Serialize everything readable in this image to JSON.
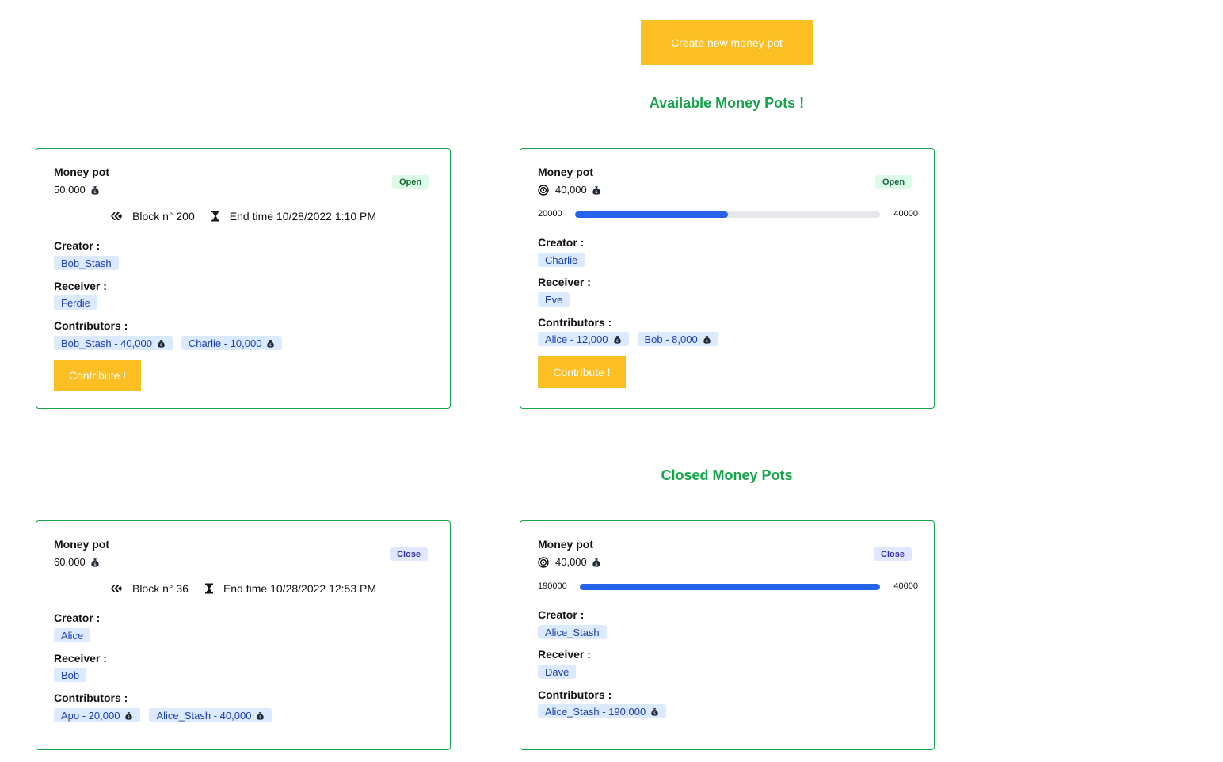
{
  "header": {
    "create_button": "Create new money pot",
    "available_title": "Available Money Pots !",
    "closed_title": "Closed Money Pots"
  },
  "labels": {
    "money_pot": "Money pot",
    "creator": "Creator :",
    "receiver": "Receiver :",
    "contributors": "Contributors :",
    "contribute": "Contribute !",
    "block_prefix": "Block n°",
    "end_prefix": "End time"
  },
  "colors": {
    "accent": "#fbbf24",
    "heading_green": "#16a34a",
    "progress_blue": "#2563eb"
  },
  "icons": [
    "money-bag-icon",
    "target-icon",
    "block-chain-icon",
    "hourglass-icon"
  ],
  "available": [
    {
      "amount": "50,000",
      "status": "Open",
      "block": "Block n° 200",
      "end_time": "End time 10/28/2022 1:10 PM",
      "creator": "Bob_Stash",
      "receiver": "Ferdie",
      "contributors": [
        "Bob_Stash - 40,000",
        "Charlie - 10,000"
      ],
      "contribute": "Contribute !"
    },
    {
      "amount": "40,000",
      "status": "Open",
      "progress_min": "20000",
      "progress_max": "40000",
      "progress_fraction": 0.5,
      "creator": "Charlie",
      "receiver": "Eve",
      "contributors": [
        "Alice - 12,000",
        "Bob - 8,000"
      ],
      "contribute": "Contribute !"
    }
  ],
  "closed": [
    {
      "amount": "60,000",
      "status": "Close",
      "block": "Block n° 36",
      "end_time": "End time 10/28/2022 12:53 PM",
      "creator": "Alice",
      "receiver": "Bob",
      "contributors": [
        "Apo - 20,000",
        "Alice_Stash - 40,000"
      ]
    },
    {
      "amount": "40,000",
      "status": "Close",
      "progress_min": "190000",
      "progress_max": "40000",
      "progress_fraction": 1.0,
      "creator": "Alice_Stash",
      "receiver": "Dave",
      "contributors": [
        "Alice_Stash - 190,000"
      ]
    }
  ]
}
